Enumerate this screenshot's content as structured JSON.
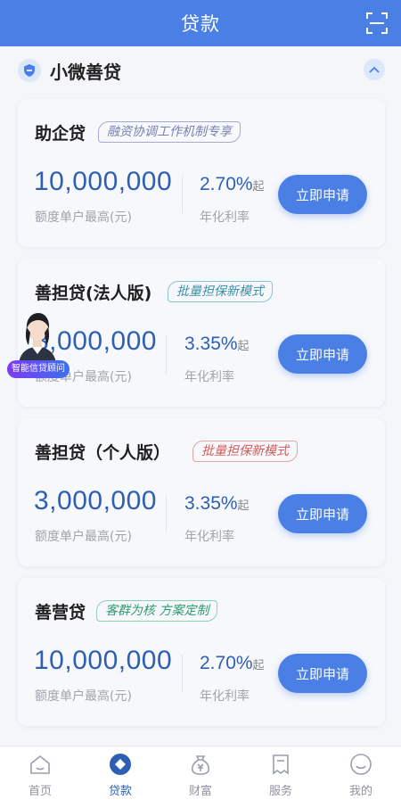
{
  "header": {
    "title": "贷款",
    "scan_icon": "scan-icon"
  },
  "section": {
    "title": "小微善贷"
  },
  "cards": [
    {
      "name": "助企贷",
      "tag": "融资协调工作机制专享",
      "tag_color": "#7b7fb0",
      "amount": "10,000,000",
      "amount_label": "额度单户最高(元)",
      "rate": "2.70%",
      "rate_suffix": "起",
      "rate_label": "年化利率",
      "button": "立即申请"
    },
    {
      "name": "善担贷(法人版)",
      "tag": "批量担保新模式",
      "tag_color": "#3a8ea8",
      "amount": "3,000,000",
      "amount_label": "额度单户最高(元)",
      "rate": "3.35%",
      "rate_suffix": "起",
      "rate_label": "年化利率",
      "button": "立即申请"
    },
    {
      "name": "善担贷（个人版）",
      "tag": "批量担保新模式",
      "tag_color": "#d35a5a",
      "amount": "3,000,000",
      "amount_label": "额度单户最高(元)",
      "rate": "3.35%",
      "rate_suffix": "起",
      "rate_label": "年化利率",
      "button": "立即申请"
    },
    {
      "name": "善营贷",
      "tag": "客群为核 方案定制",
      "tag_color": "#2e9a6e",
      "amount": "10,000,000",
      "amount_label": "额度单户最高(元)",
      "rate": "2.70%",
      "rate_suffix": "起",
      "rate_label": "年化利率",
      "button": "立即申请"
    }
  ],
  "advisor": {
    "label": "智能信贷顾问"
  },
  "tabbar": {
    "items": [
      {
        "label": "首页",
        "icon": "home-icon"
      },
      {
        "label": "贷款",
        "icon": "loan-icon",
        "active": true
      },
      {
        "label": "财富",
        "icon": "wealth-icon"
      },
      {
        "label": "服务",
        "icon": "service-icon"
      },
      {
        "label": "我的",
        "icon": "profile-icon"
      }
    ]
  },
  "colors": {
    "primary": "#4a7fe6",
    "amount": "#2f5fb3",
    "muted": "#a0a4ad"
  }
}
